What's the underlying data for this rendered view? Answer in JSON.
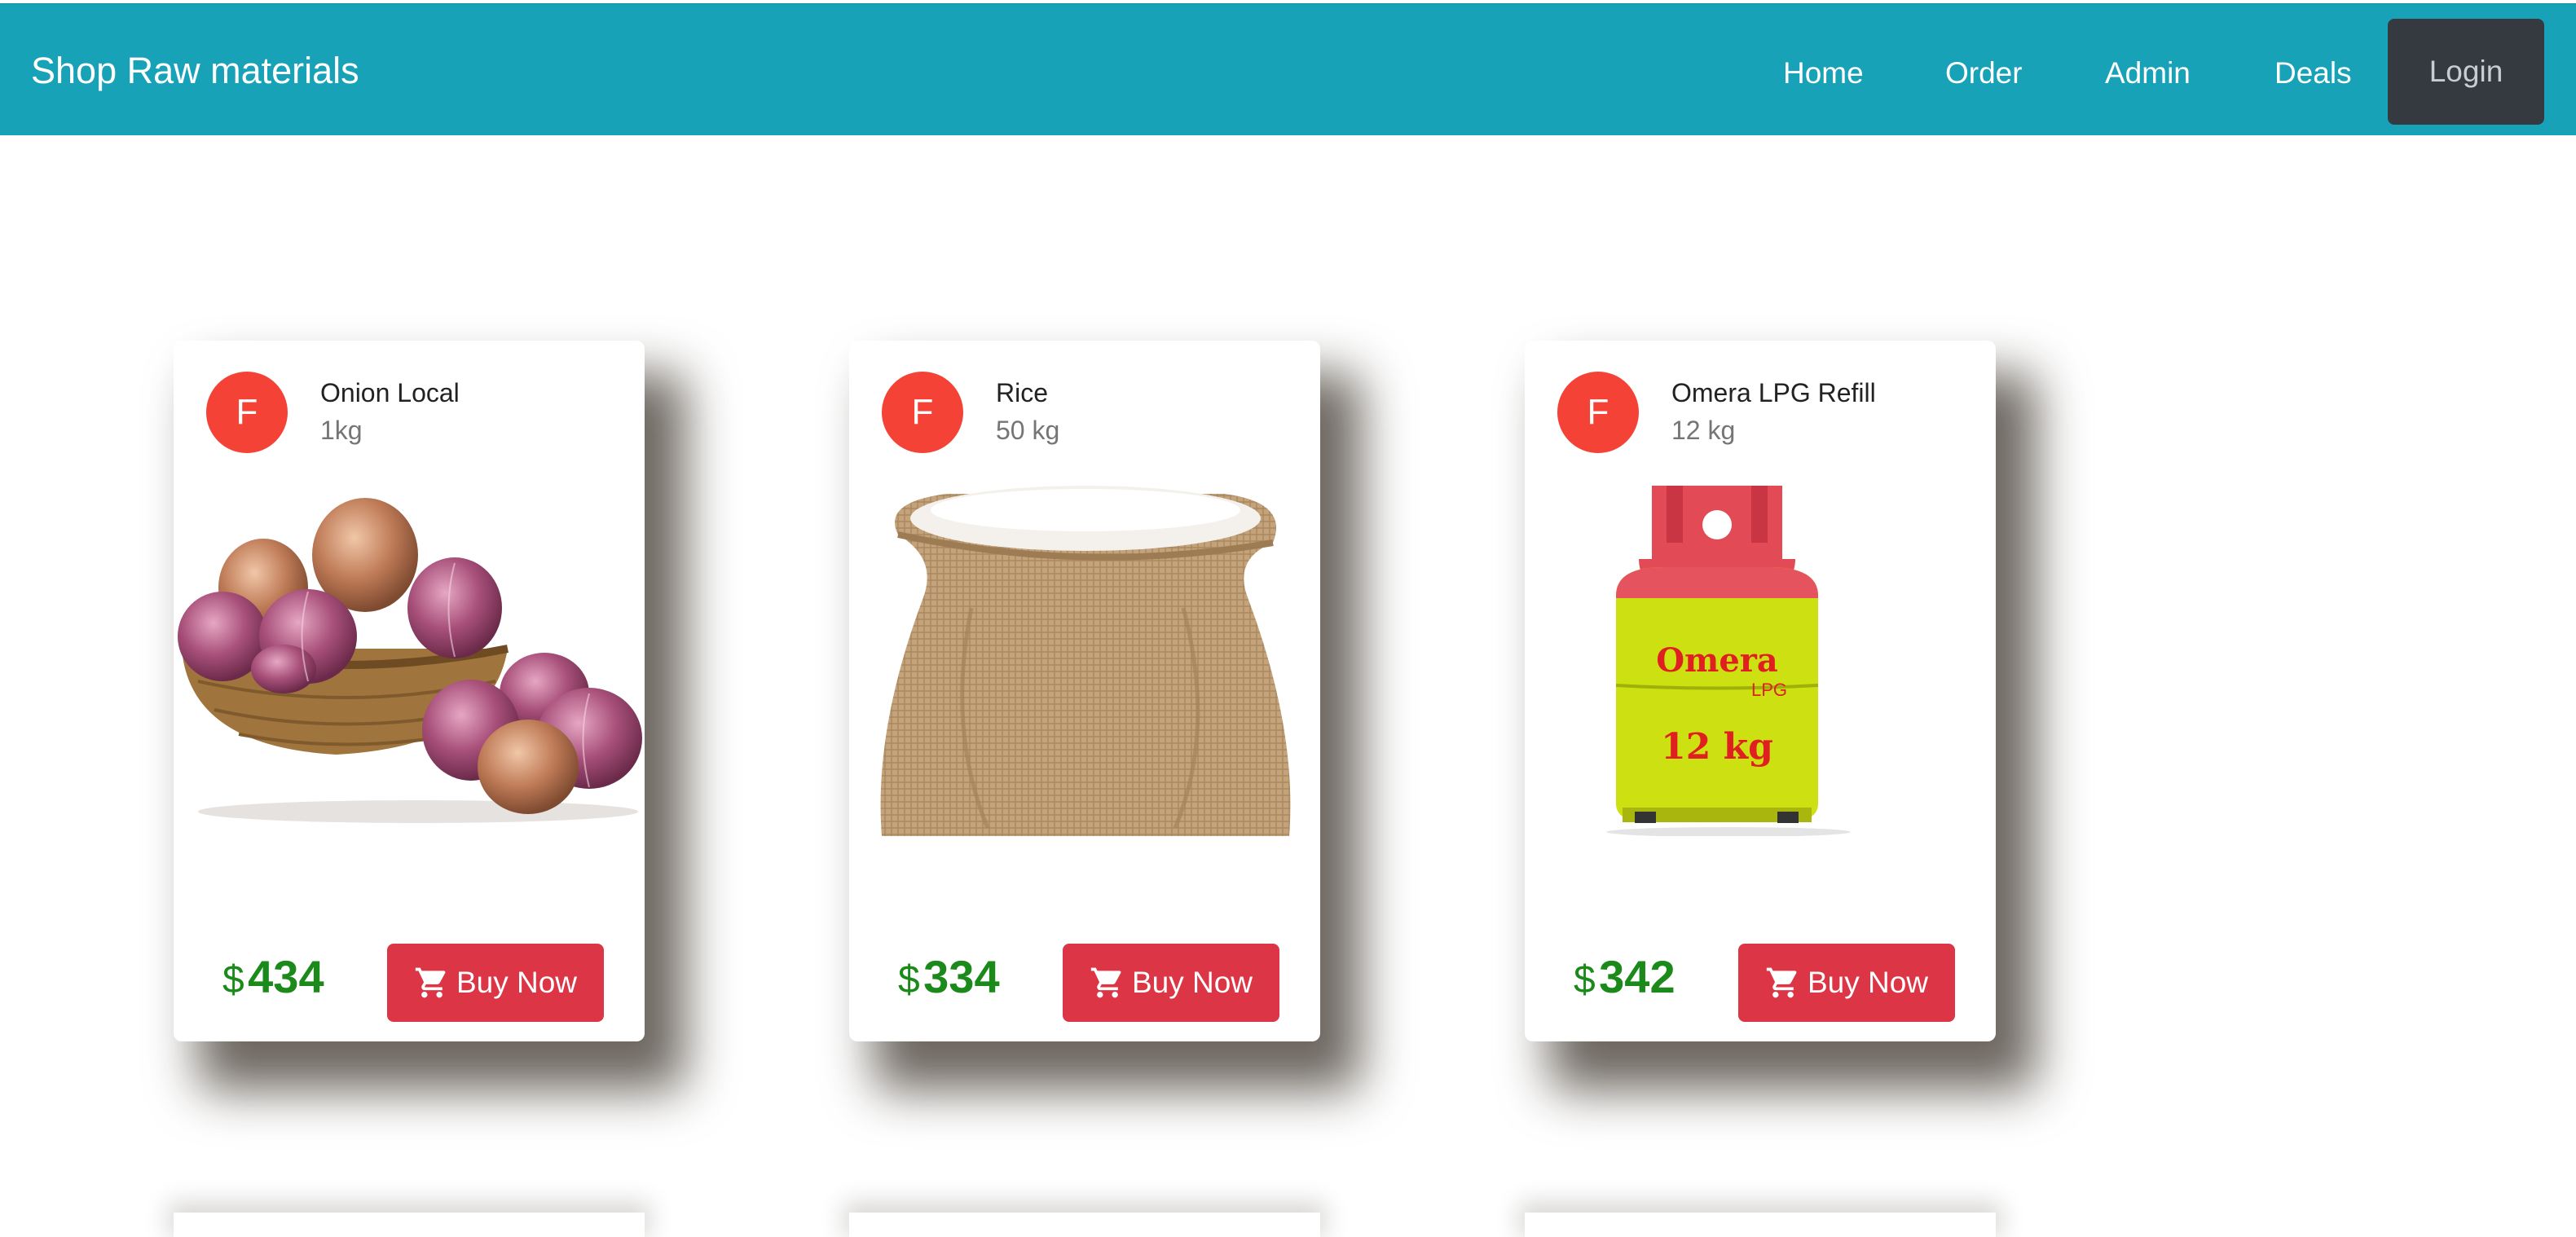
{
  "navbar": {
    "brand": "Shop Raw materials",
    "links": [
      "Home",
      "Order",
      "Admin",
      "Deals"
    ],
    "login_label": "Login",
    "color": "#17a2b8"
  },
  "products": [
    {
      "avatar": "F",
      "name": "Onion Local",
      "quantity": "1kg",
      "currency": "$",
      "price": "434",
      "buy_label": "Buy Now",
      "image": "onion-basket"
    },
    {
      "avatar": "F",
      "name": "Rice",
      "quantity": "50 kg",
      "currency": "$",
      "price": "334",
      "buy_label": "Buy Now",
      "image": "rice-sack"
    },
    {
      "avatar": "F",
      "name": "Omera LPG Refill",
      "quantity": "12 kg",
      "currency": "$",
      "price": "342",
      "buy_label": "Buy Now",
      "image": "lpg-cylinder",
      "image_text": {
        "brand": "Omera",
        "sub": "LPG",
        "weight": "12 kg"
      }
    }
  ],
  "icons": {
    "cart": "cart-icon"
  },
  "colors": {
    "avatar": "#f44336",
    "buy": "#dc3545",
    "price": "#1b8a1b",
    "login": "#343a40"
  }
}
